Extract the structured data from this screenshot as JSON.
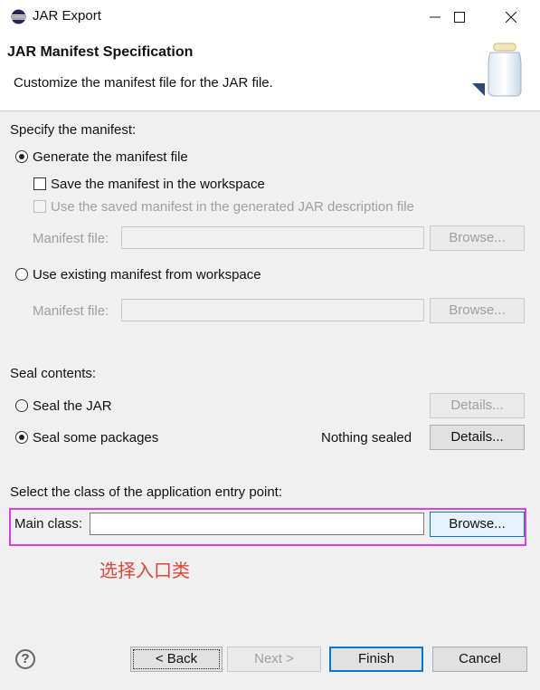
{
  "window": {
    "title": "JAR Export",
    "minimize_glyph": "—",
    "maximize_glyph": "☐",
    "close_glyph": "✕"
  },
  "header": {
    "title": "JAR Manifest Specification",
    "subtitle": "Customize the manifest file for the JAR file."
  },
  "manifest": {
    "section_label": "Specify the manifest:",
    "generate_label": "Generate the manifest file",
    "generate_selected": true,
    "save_label": "Save the manifest in the workspace",
    "save_checked": false,
    "use_saved_label": "Use the saved manifest in the generated JAR description file",
    "manifest_file_label_1": "Manifest file:",
    "manifest_file_value_1": "",
    "browse_label_1": "Browse...",
    "use_existing_label": "Use existing manifest from workspace",
    "use_existing_selected": false,
    "manifest_file_label_2": "Manifest file:",
    "manifest_file_value_2": "",
    "browse_label_2": "Browse..."
  },
  "seal": {
    "section_label": "Seal contents:",
    "seal_jar_label": "Seal the JAR",
    "seal_jar_selected": false,
    "details_label_1": "Details...",
    "seal_packages_label": "Seal some packages",
    "seal_packages_selected": true,
    "nothing_sealed": "Nothing sealed",
    "details_label_2": "Details..."
  },
  "entry": {
    "section_label": "Select the class of the application entry point:",
    "main_class_label": "Main class:",
    "main_class_value": "",
    "browse_label": "Browse..."
  },
  "annotation": {
    "text": "选择入口类",
    "color": "#e0453a",
    "box_color": "#e040e0"
  },
  "footer": {
    "help_glyph": "?",
    "back_label": "< Back",
    "next_label": "Next >",
    "finish_label": "Finish",
    "cancel_label": "Cancel"
  }
}
